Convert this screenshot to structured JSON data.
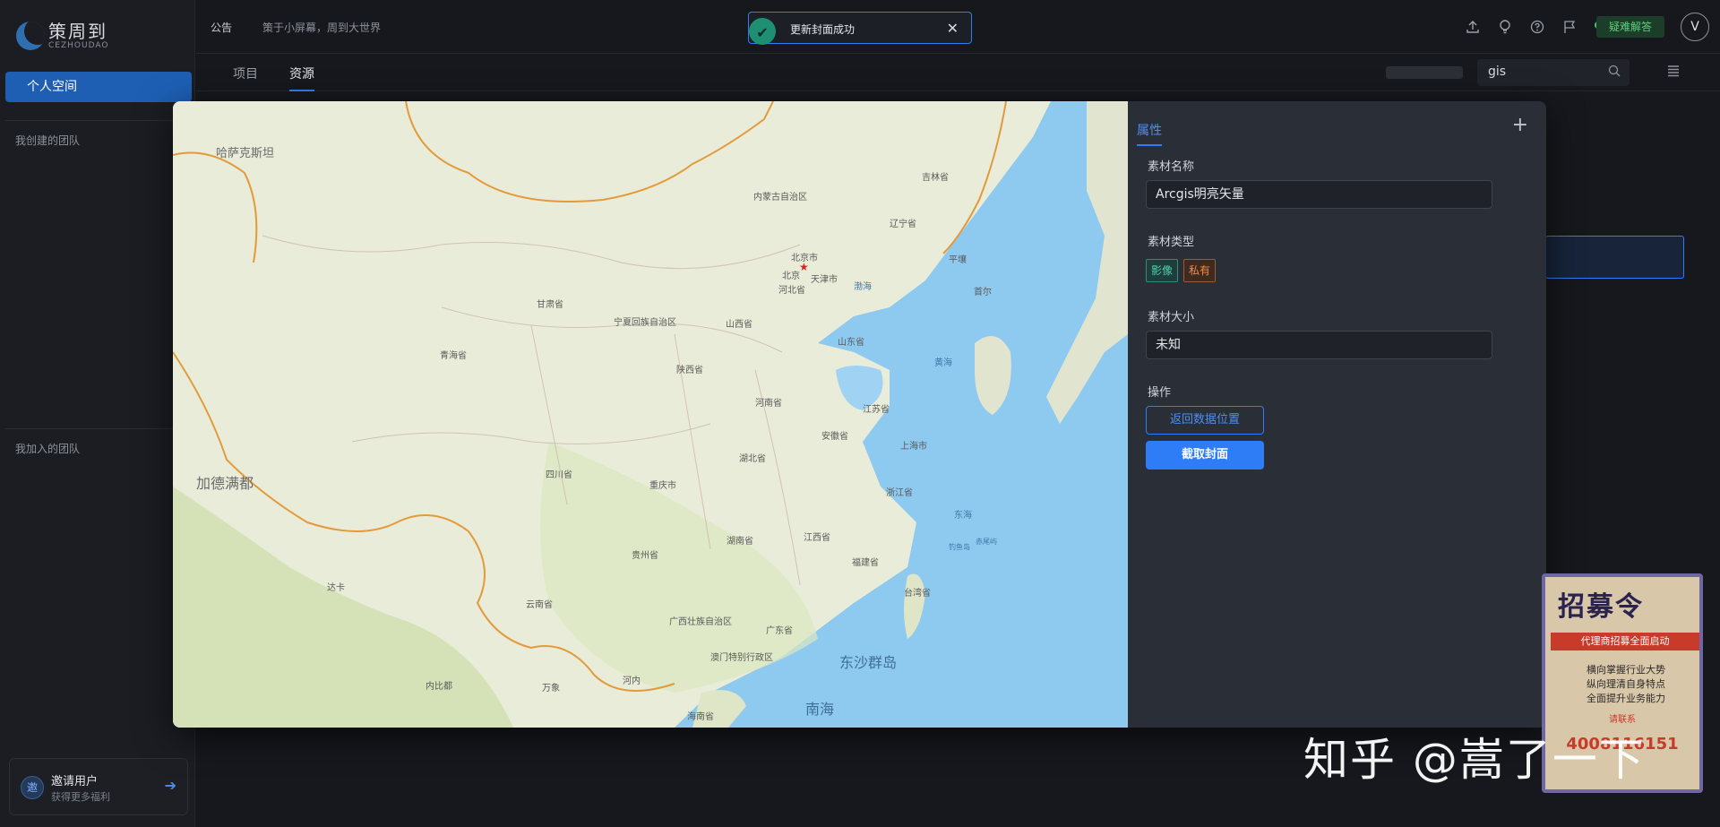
{
  "app": {
    "logo_cn": "策周到",
    "logo_en": "CEZHOUDAO"
  },
  "sidebar": {
    "personal_space": "个人空间",
    "created_teams": "我创建的团队",
    "joined_teams": "我加入的团队",
    "invite": {
      "avatar": "邀",
      "title": "邀请用户",
      "subtitle": "获得更多福利"
    }
  },
  "header": {
    "notice_tag": "公告",
    "notice_text": "策于小屏幕，周到大世界",
    "qa_label": "疑难解答",
    "user_initial": "V"
  },
  "tabs": [
    {
      "label": "项目"
    },
    {
      "label": "资源"
    }
  ],
  "search": {
    "value": "gis"
  },
  "toast": {
    "message": "更新封面成功"
  },
  "modal": {
    "panel_tab": "属性",
    "fields": {
      "name_label": "素材名称",
      "name_value": "Arcgis明亮矢量",
      "type_label": "素材类型",
      "type_tags": [
        "影像",
        "私有"
      ],
      "size_label": "素材大小",
      "size_value": "未知",
      "actions_label": "操作"
    },
    "buttons": {
      "return_location": "返回数据位置",
      "capture_cover": "截取封面"
    },
    "map_labels": {
      "inner_mongolia": "内蒙古自治区",
      "beijing_city": "北京市",
      "beijing": "北京",
      "tianjin": "天津市",
      "hebei": "河北省",
      "gansu": "甘肃省",
      "ningxia": "宁夏回族自治区",
      "shanxi": "山西省",
      "shandong": "山东省",
      "qinghai": "青海省",
      "shaanxi": "陕西省",
      "henan": "河南省",
      "jiangsu": "江苏省",
      "anhui": "安徽省",
      "shanghai": "上海市",
      "sichuan": "四川省",
      "hubei": "湖北省",
      "chongqing": "重庆市",
      "zhejiang": "浙江省",
      "guizhou": "贵州省",
      "hunan": "湖南省",
      "jiangxi": "江西省",
      "fujian": "福建省",
      "yunnan": "云南省",
      "guangxi": "广西壮族自治区",
      "guangdong": "广东省",
      "macau": "澳门特别行政区",
      "taiwan": "台湾省",
      "hainan": "海南省",
      "liaoning": "辽宁省",
      "jilin": "吉林省",
      "bohai": "渤海",
      "yellow_sea": "黄海",
      "east_sea": "东海",
      "dongsha": "东沙群岛",
      "south_sea": "南海",
      "pyongyang": "平壤",
      "seoul": "首尔",
      "hanoi": "河内",
      "kathmandu": "加德满都",
      "dhaka": "达卡",
      "vientiane": "万象",
      "kazakhstan": "哈萨克斯坦",
      "diaoyu": "钓鱼岛",
      "chiwei": "赤尾屿",
      "neibidu": "内比都"
    }
  },
  "poster": {
    "title": "招募令",
    "banner": "代理商招募全面启动",
    "lines": [
      "横向掌握行业大势",
      "纵向理清自身特点",
      "全面提升业务能力"
    ],
    "contact": "请联系",
    "phone": "4008116151"
  },
  "watermark": "知乎 @嵩了一下",
  "colors": {
    "accent": "#2f7df6",
    "success": "#1f8f74",
    "sea": "#8ec9ef",
    "land": "#e9ecd8",
    "border": "#e39a3b"
  },
  "icons": [
    "upload-icon",
    "lightbulb-icon",
    "help-icon",
    "flag-icon",
    "wechat-icon",
    "search-icon",
    "list-icon",
    "close-icon",
    "check-icon",
    "arrow-right-icon"
  ]
}
